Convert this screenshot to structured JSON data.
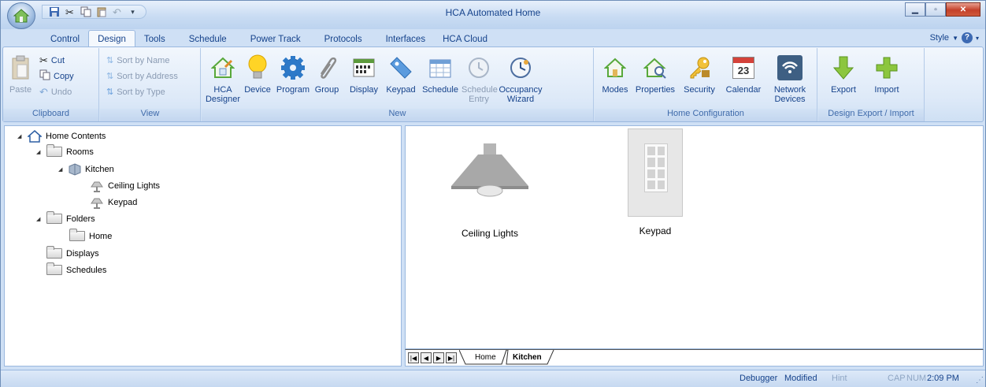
{
  "window": {
    "title": "HCA Automated Home"
  },
  "quick_access": {
    "icons": [
      "save-icon",
      "cut-icon",
      "copy-icon",
      "paste-icon",
      "undo-icon",
      "customize-dropdown-icon"
    ]
  },
  "tabs": [
    "Control",
    "Design",
    "Tools",
    "Schedule",
    "Power Track",
    "Protocols",
    "Interfaces",
    "HCA Cloud"
  ],
  "active_tab": "Design",
  "style_menu": {
    "label": "Style"
  },
  "ribbon": {
    "clipboard": {
      "label": "Clipboard",
      "paste": "Paste",
      "cut": "Cut",
      "copy": "Copy",
      "undo": "Undo"
    },
    "view": {
      "label": "View",
      "sort_name": "Sort by Name",
      "sort_address": "Sort by Address",
      "sort_type": "Sort by Type"
    },
    "new": {
      "label": "New",
      "hca_designer": "HCA Designer",
      "device": "Device",
      "program": "Program",
      "group": "Group",
      "display": "Display",
      "keypad": "Keypad",
      "schedule": "Schedule",
      "schedule_entry": "Schedule Entry",
      "occupancy_wizard": "Occupancy Wizard"
    },
    "home_config": {
      "label": "Home Configuration",
      "modes": "Modes",
      "properties": "Properties",
      "security": "Security",
      "calendar": "Calendar",
      "calendar_day": "23",
      "network_devices": "Network Devices"
    },
    "export_import": {
      "label": "Design Export / Import",
      "export": "Export",
      "import": "Import"
    }
  },
  "tree": {
    "root": "Home Contents",
    "rooms": "Rooms",
    "kitchen": "Kitchen",
    "ceiling_lights": "Ceiling Lights",
    "keypad": "Keypad",
    "folders": "Folders",
    "home": "Home",
    "displays": "Displays",
    "schedules": "Schedules"
  },
  "canvas": {
    "items": [
      "Ceiling Lights",
      "Keypad"
    ]
  },
  "sheet_tabs": [
    "Home",
    "Kitchen"
  ],
  "active_sheet": "Kitchen",
  "status": {
    "debugger": "Debugger",
    "modified": "Modified",
    "hint": "Hint",
    "cap": "CAP",
    "num": "NUM",
    "time": "2:09 PM"
  }
}
